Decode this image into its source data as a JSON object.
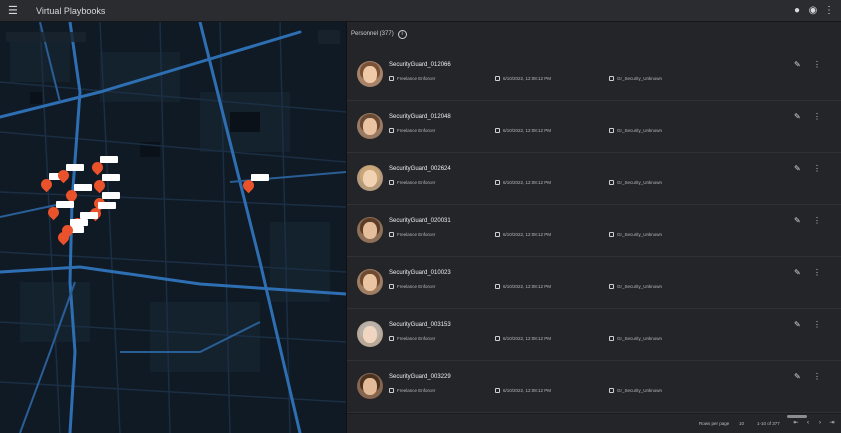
{
  "app": {
    "title": "Virtual Playbooks",
    "menu_icon": "menu-icon",
    "top_icons": [
      "notifications-icon",
      "account-icon",
      "more-vertical-icon"
    ]
  },
  "map": {
    "footer": "",
    "pins": [
      {
        "name": "pin-1"
      },
      {
        "name": "pin-2"
      },
      {
        "name": "pin-3"
      },
      {
        "name": "pin-4"
      },
      {
        "name": "pin-5"
      },
      {
        "name": "pin-6"
      },
      {
        "name": "pin-7"
      },
      {
        "name": "pin-8"
      },
      {
        "name": "pin-9"
      },
      {
        "name": "pin-10"
      },
      {
        "name": "pin-11"
      },
      {
        "name": "pin-12"
      }
    ]
  },
  "panel": {
    "title": "Personnel (377)",
    "info_icon": "info-circle-icon"
  },
  "records": [
    {
      "name": "SecurityGuard_012066",
      "role": "Freelance Enforcer",
      "date": "6/10/2022, 12:08:12 PM",
      "unit": "Gr_Security_Unknown",
      "hair": "#7a5238",
      "bg": "#a7836a",
      "face": "#efc9a8"
    },
    {
      "name": "SecurityGuard_012048",
      "role": "Freelance Enforcer",
      "date": "6/10/2022, 12:08:12 PM",
      "unit": "Gr_Security_Unknown",
      "hair": "#6b4a33",
      "bg": "#9a7a62",
      "face": "#e9c3a2"
    },
    {
      "name": "SecurityGuard_002624",
      "role": "Freelance Enforcer",
      "date": "6/10/2022, 12:08:12 PM",
      "unit": "Gr_Security_Unknown",
      "hair": "#c9a779",
      "bg": "#b69a7c",
      "face": "#f1d2b3"
    },
    {
      "name": "SecurityGuard_020031",
      "role": "Freelance Enforcer",
      "date": "6/10/2022, 12:08:12 PM",
      "unit": "Gr_Security_Unknown",
      "hair": "#5c3d27",
      "bg": "#8e6f58",
      "face": "#e5bf9c"
    },
    {
      "name": "SecurityGuard_010023",
      "role": "Freelance Enforcer",
      "date": "6/10/2022, 12:08:12 PM",
      "unit": "Gr_Security_Unknown",
      "hair": "#6e4a30",
      "bg": "#9f7d63",
      "face": "#ebc4a2"
    },
    {
      "name": "SecurityGuard_003153",
      "role": "Freelance Enforcer",
      "date": "6/10/2022, 12:08:12 PM",
      "unit": "Gr_Security_Unknown",
      "hair": "#b9b2aa",
      "bg": "#b8a898",
      "face": "#f0d6c0"
    },
    {
      "name": "SecurityGuard_003229",
      "role": "Freelance Enforcer",
      "date": "6/10/2022, 12:08:12 PM",
      "unit": "Gr_Security_Unknown",
      "hair": "#4d3220",
      "bg": "#86664f",
      "face": "#e3bb98"
    }
  ],
  "pager": {
    "rows_label": "Rows per page",
    "rows_value": "10",
    "range": "1-10 of 377",
    "buttons": [
      "first-page-icon",
      "prev-page-icon",
      "next-page-icon",
      "last-page-icon"
    ]
  }
}
